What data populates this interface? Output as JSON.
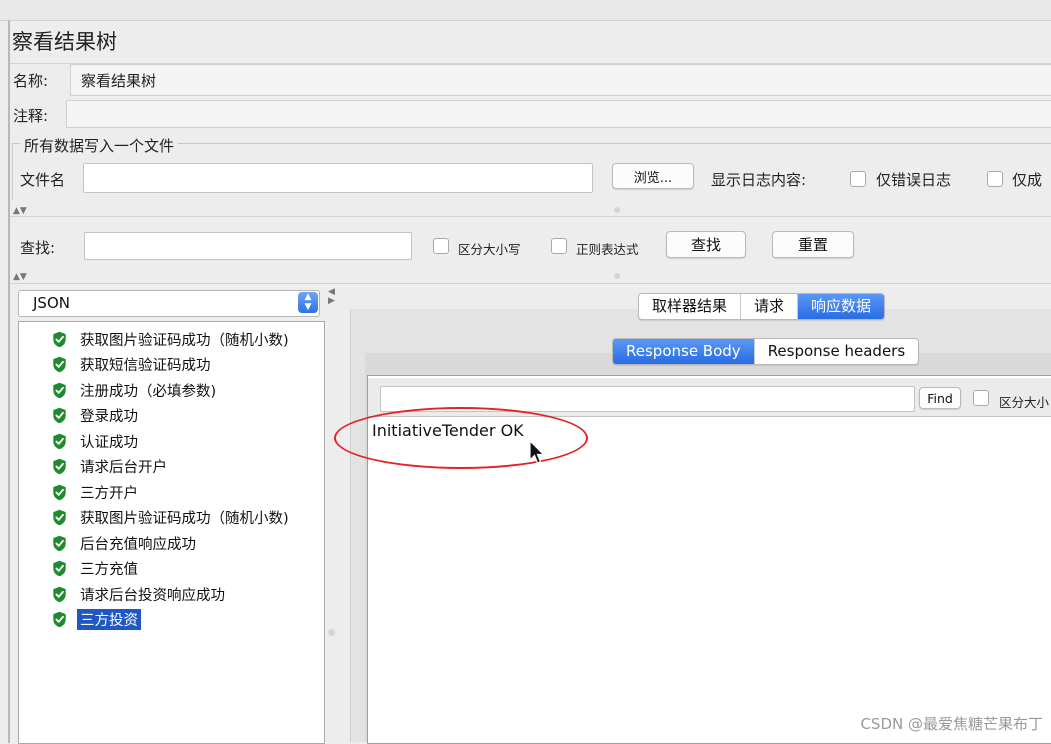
{
  "title": "察看结果树",
  "name_label": "名称:",
  "name_value": "察看结果树",
  "comment_label": "注释:",
  "comment_value": "",
  "file_section": {
    "legend": "所有数据写入一个文件",
    "filename_label": "文件名",
    "filename_value": "",
    "browse_label": "浏览...",
    "log_label": "显示日志内容:",
    "errors_only_label": "仅错误日志",
    "success_only_label": "仅成"
  },
  "search": {
    "label": "查找:",
    "value": "",
    "case_label": "区分大小写",
    "regex_label": "正则表达式",
    "find_label": "查找",
    "reset_label": "重置"
  },
  "renderer": {
    "selected": "JSON"
  },
  "tree_items": [
    {
      "label": "获取图片验证码成功（随机小数)"
    },
    {
      "label": "获取短信验证码成功"
    },
    {
      "label": "注册成功（必填参数)"
    },
    {
      "label": "登录成功"
    },
    {
      "label": "认证成功"
    },
    {
      "label": "请求后台开户"
    },
    {
      "label": "三方开户"
    },
    {
      "label": "获取图片验证码成功（随机小数)"
    },
    {
      "label": "后台充值响应成功"
    },
    {
      "label": "三方充值"
    },
    {
      "label": "请求后台投资响应成功"
    },
    {
      "label": "三方投资"
    }
  ],
  "selected_index": 11,
  "result_tabs": [
    "取样器结果",
    "请求",
    "响应数据"
  ],
  "result_tab_active": 2,
  "response_tabs": [
    "Response Body",
    "Response headers"
  ],
  "response_tab_active": 0,
  "response_find": {
    "value": "",
    "find_label": "Find",
    "case_label": "区分大小"
  },
  "response_body": "InitiativeTender OK",
  "watermark": "CSDN @最爱焦糖芒果布丁",
  "colors": {
    "success_icon": "#1f8a2e",
    "selection": "#1f58c4",
    "active_tab": "#2a6be3",
    "annotation": "#e0242a"
  }
}
